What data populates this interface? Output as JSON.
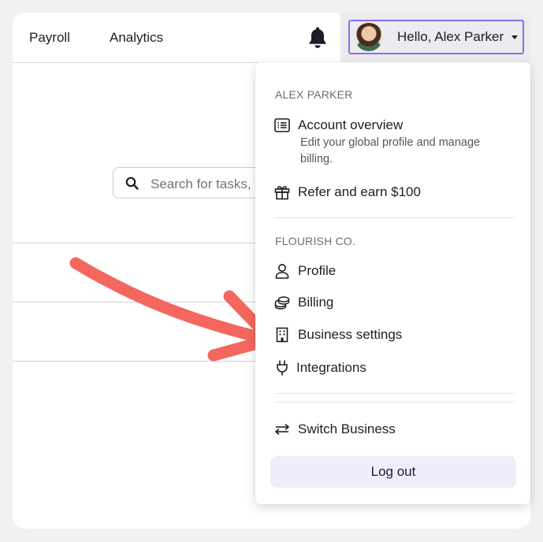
{
  "header": {
    "nav": [
      {
        "label": "Payroll"
      },
      {
        "label": "Analytics"
      }
    ],
    "notification_icon": "bell-icon",
    "user_greeting": "Hello, Alex Parker",
    "focus_ring_color": "#8b6cf0"
  },
  "search": {
    "placeholder": "Search for tasks,"
  },
  "annotation": {
    "arrow_color": "#f3675e"
  },
  "menu": {
    "personal_section": "ALEX PARKER",
    "account_overview": {
      "label": "Account overview",
      "description": "Edit your global profile and manage billing.",
      "icon": "list-icon"
    },
    "refer": {
      "label": "Refer and earn $100",
      "icon": "gift-icon"
    },
    "business_section": "FLOURISH CO.",
    "business_items": [
      {
        "label": "Profile",
        "icon": "person-icon"
      },
      {
        "label": "Billing",
        "icon": "coins-icon"
      },
      {
        "label": "Business settings",
        "icon": "building-icon"
      },
      {
        "label": "Integrations",
        "icon": "plug-icon"
      }
    ],
    "switch_business": {
      "label": "Switch Business",
      "icon": "switch-arrows-icon"
    },
    "logout_label": "Log out",
    "logout_bg": "#efedfb"
  }
}
